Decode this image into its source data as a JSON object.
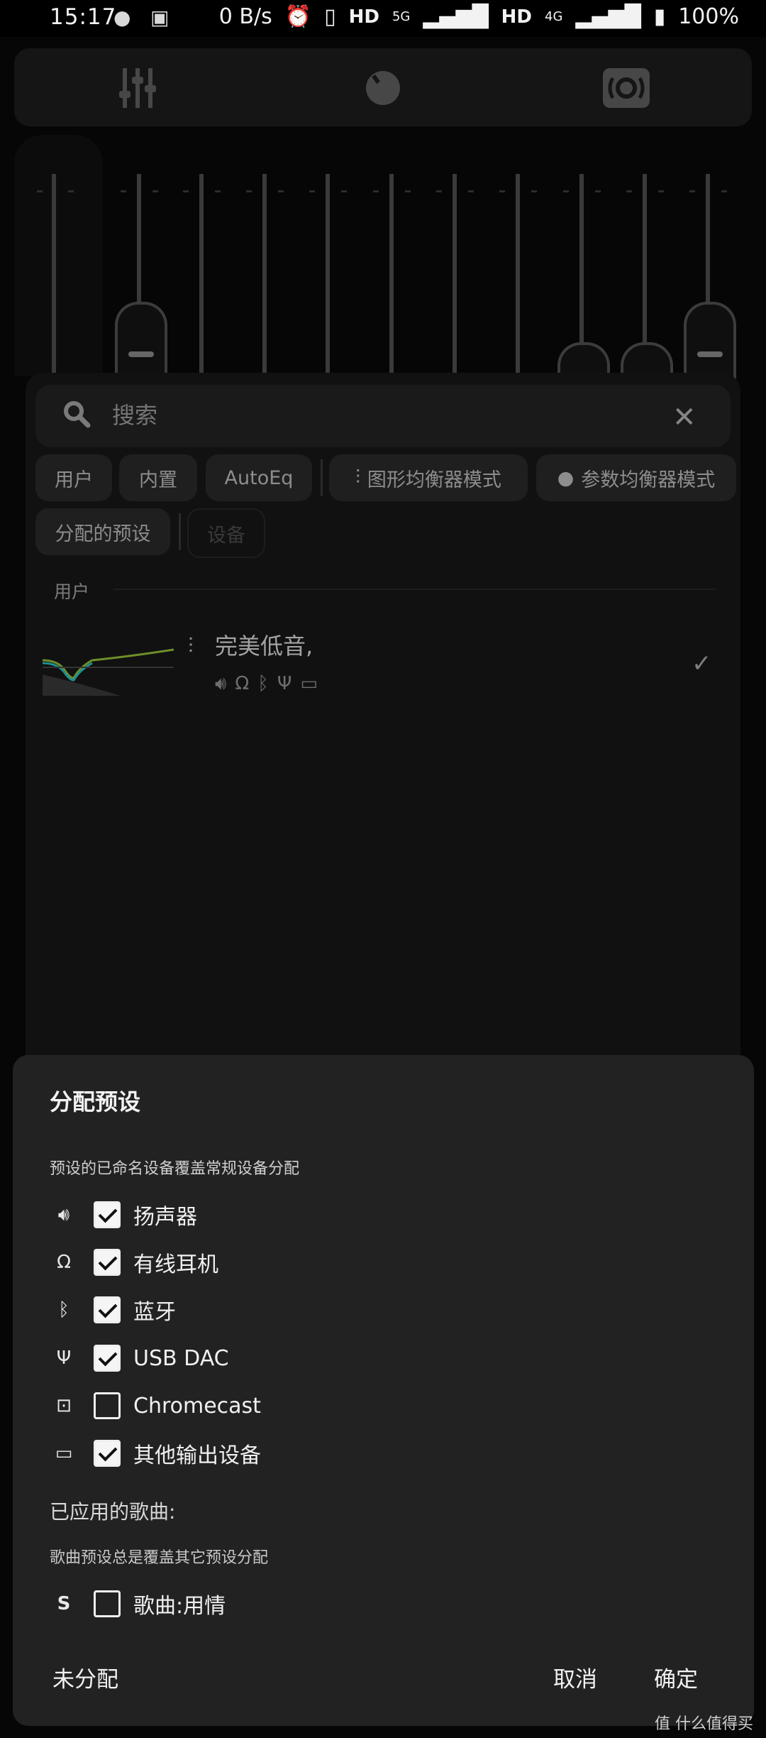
{
  "status_bar": {
    "time": "15:17",
    "network_speed": "0 B/s",
    "hd1": "HD",
    "net1": "5G",
    "hd2": "HD",
    "net2": "4G",
    "battery": "100%"
  },
  "search": {
    "placeholder": "搜索"
  },
  "filters": {
    "chips": [
      "用户",
      "内置",
      "AutoEq",
      "图形均衡器模式",
      "参数均衡器模式",
      "分配的预设",
      "设备"
    ]
  },
  "preset_list": {
    "section_label": "用户",
    "items": [
      {
        "name": "完美低音,",
        "devices": [
          "speaker-icon",
          "headphones-icon",
          "bluetooth-icon",
          "usb-icon",
          "other-output-icon"
        ],
        "selected": true
      }
    ]
  },
  "dialog": {
    "title": "分配预设",
    "subtitle": "预设的已命名设备覆盖常规设备分配",
    "devices": [
      {
        "icon": "speaker-icon",
        "label": "扬声器",
        "checked": true
      },
      {
        "icon": "headphones-icon",
        "label": "有线耳机",
        "checked": true
      },
      {
        "icon": "bluetooth-icon",
        "label": "蓝牙",
        "checked": true
      },
      {
        "icon": "usb-icon",
        "label": "USB DAC",
        "checked": true
      },
      {
        "icon": "cast-icon",
        "label": "Chromecast",
        "checked": false
      },
      {
        "icon": "other-output-icon",
        "label": "其他输出设备",
        "checked": true
      }
    ],
    "songs_label": "已应用的歌曲:",
    "songs_subtitle": "歌曲预设总是覆盖其它预设分配",
    "song_row": {
      "icon_letter": "S",
      "label": "歌曲:用情",
      "checked": false
    },
    "buttons": {
      "unassign": "未分配",
      "cancel": "取消",
      "ok": "确定"
    }
  },
  "watermark": "值 什么值得买"
}
